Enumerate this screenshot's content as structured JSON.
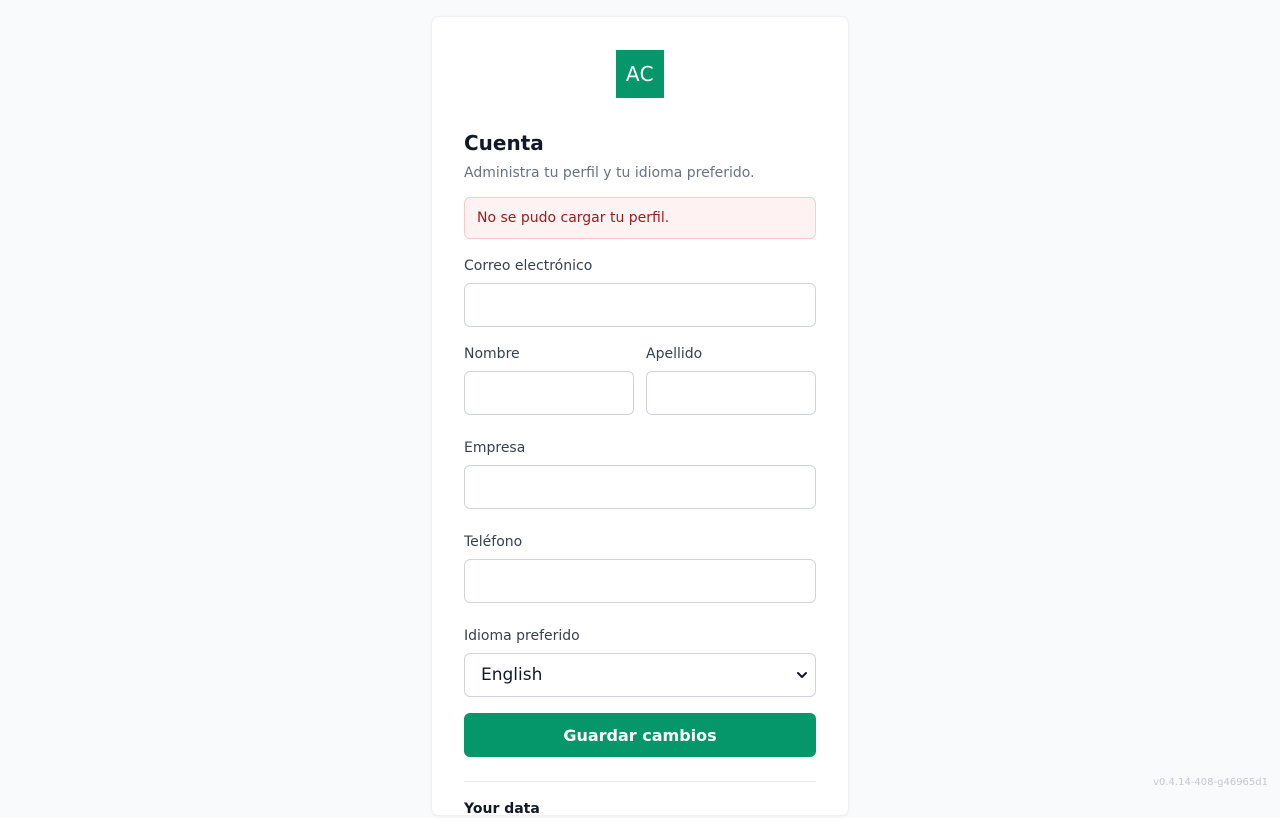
{
  "brand": {
    "logo_text": "AC",
    "color": "#059669"
  },
  "page": {
    "title": "Cuenta",
    "subtitle": "Administra tu perfil y tu idioma preferido."
  },
  "alert": {
    "message": "No se pudo cargar tu perfil.",
    "color": "#991b1b"
  },
  "form": {
    "email": {
      "label": "Correo electrónico",
      "value": ""
    },
    "first_name": {
      "label": "Nombre",
      "value": ""
    },
    "last_name": {
      "label": "Apellido",
      "value": ""
    },
    "company": {
      "label": "Empresa",
      "value": ""
    },
    "phone": {
      "label": "Teléfono",
      "value": ""
    },
    "language": {
      "label": "Idioma preferido",
      "selected": "English"
    },
    "submit_label": "Guardar cambios"
  },
  "data_section": {
    "title": "Your data"
  },
  "footer": {
    "version": "v0.4.14-408-g46965d1"
  }
}
